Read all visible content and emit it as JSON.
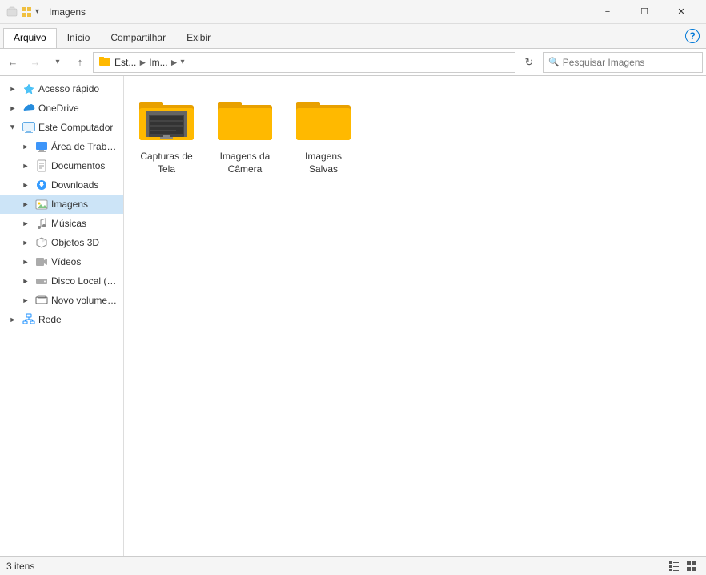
{
  "titleBar": {
    "title": "Imagens",
    "minLabel": "−",
    "maxLabel": "☐",
    "closeLabel": "✕"
  },
  "ribbon": {
    "tabs": [
      {
        "label": "Arquivo",
        "active": true
      },
      {
        "label": "Início",
        "active": false
      },
      {
        "label": "Compartilhar",
        "active": false
      },
      {
        "label": "Exibir",
        "active": false
      }
    ]
  },
  "addressBar": {
    "pathParts": [
      "Est...",
      "Im...",
      ""
    ],
    "searchPlaceholder": "Pesquisar Imagens"
  },
  "sidebar": {
    "items": [
      {
        "id": "quick-access",
        "label": "Acesso rápido",
        "icon": "star",
        "indent": 1,
        "hasExpand": true,
        "expanded": false
      },
      {
        "id": "onedrive",
        "label": "OneDrive",
        "icon": "cloud",
        "indent": 1,
        "hasExpand": true,
        "expanded": false
      },
      {
        "id": "this-pc",
        "label": "Este Computador",
        "icon": "computer",
        "indent": 1,
        "hasExpand": true,
        "expanded": true
      },
      {
        "id": "desktop",
        "label": "Área de Trabalho",
        "icon": "desktop",
        "indent": 2,
        "hasExpand": true,
        "expanded": false
      },
      {
        "id": "documents",
        "label": "Documentos",
        "icon": "docs",
        "indent": 2,
        "hasExpand": true,
        "expanded": false
      },
      {
        "id": "downloads",
        "label": "Downloads",
        "icon": "downloads",
        "indent": 2,
        "hasExpand": true,
        "expanded": false
      },
      {
        "id": "images",
        "label": "Imagens",
        "icon": "images",
        "indent": 2,
        "hasExpand": true,
        "expanded": false,
        "selected": true
      },
      {
        "id": "music",
        "label": "Músicas",
        "icon": "music",
        "indent": 2,
        "hasExpand": true,
        "expanded": false
      },
      {
        "id": "objects3d",
        "label": "Objetos 3D",
        "icon": "3d",
        "indent": 2,
        "hasExpand": true,
        "expanded": false
      },
      {
        "id": "videos",
        "label": "Vídeos",
        "icon": "video",
        "indent": 2,
        "hasExpand": true,
        "expanded": false
      },
      {
        "id": "local-disk",
        "label": "Disco Local (C:)",
        "icon": "drive-c",
        "indent": 2,
        "hasExpand": true,
        "expanded": false
      },
      {
        "id": "new-volume",
        "label": "Novo volume (E:)",
        "icon": "drive-e",
        "indent": 2,
        "hasExpand": true,
        "expanded": false
      },
      {
        "id": "network",
        "label": "Rede",
        "icon": "network",
        "indent": 1,
        "hasExpand": true,
        "expanded": false
      }
    ]
  },
  "content": {
    "folders": [
      {
        "id": "capturas",
        "label": "Capturas de Tela",
        "hasPreview": true
      },
      {
        "id": "camera",
        "label": "Imagens da Câmera",
        "hasPreview": false
      },
      {
        "id": "saved",
        "label": "Imagens Salvas",
        "hasPreview": false
      }
    ]
  },
  "statusBar": {
    "itemCount": "3 itens"
  }
}
